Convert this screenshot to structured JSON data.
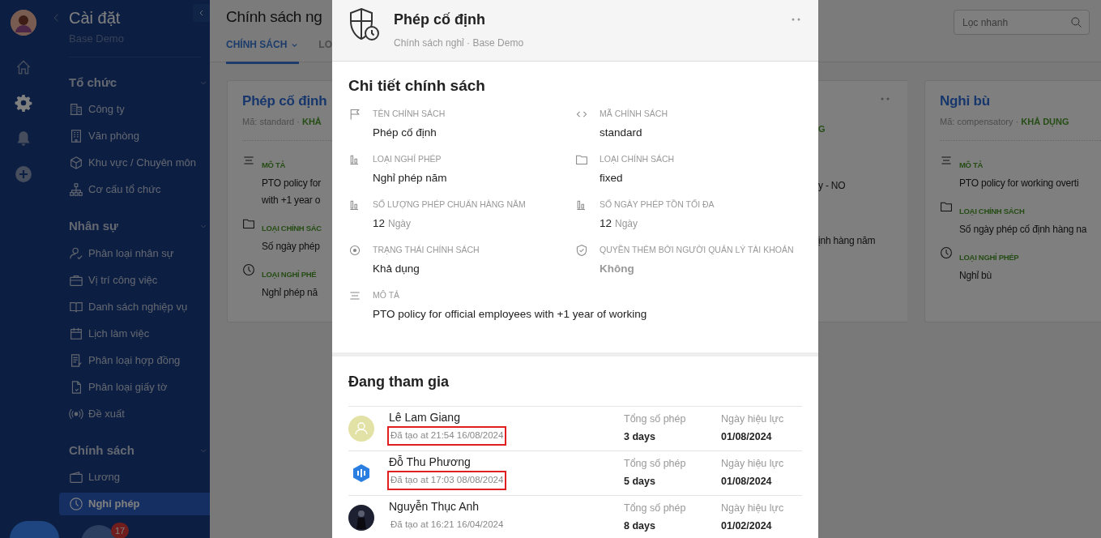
{
  "rail": {
    "items": [
      {
        "selected": false
      },
      {
        "selected": true
      },
      {
        "selected": false
      },
      {
        "selected": false
      }
    ]
  },
  "sidebar": {
    "title": "Cài đặt",
    "subtitle": "Base Demo",
    "groups": [
      {
        "title": "Tổ chức",
        "expanded": true,
        "items": [
          {
            "label": "Công ty",
            "selected": false
          },
          {
            "label": "Văn phòng",
            "selected": false
          },
          {
            "label": "Khu vực / Chuyên môn",
            "selected": false
          },
          {
            "label": "Cơ cấu tổ chức",
            "selected": false
          }
        ]
      },
      {
        "title": "Nhân sự",
        "expanded": true,
        "items": [
          {
            "label": "Phân loại nhân sự",
            "selected": false
          },
          {
            "label": "Vị trí công việc",
            "selected": false
          },
          {
            "label": "Danh sách nghiệp vụ",
            "selected": false
          },
          {
            "label": "Lịch làm việc",
            "selected": false
          },
          {
            "label": "Phân loại hợp đồng",
            "selected": false
          },
          {
            "label": "Phân loại giấy tờ",
            "selected": false
          },
          {
            "label": "Đề xuất",
            "selected": false
          }
        ]
      },
      {
        "title": "Chính sách",
        "expanded": true,
        "items": [
          {
            "label": "Lương",
            "selected": false
          },
          {
            "label": "Nghỉ phép",
            "selected": true
          }
        ]
      }
    ]
  },
  "notification_badge": "17",
  "header": {
    "title": "Chính sách ng",
    "tabs": [
      {
        "label": "CHÍNH SÁCH",
        "selected": true,
        "dropdown": true
      },
      {
        "label": "LO",
        "selected": false,
        "dropdown": false
      }
    ],
    "search": {
      "placeholder": "Lọc nhanh"
    }
  },
  "cards": [
    {
      "kind": "full",
      "menu": false,
      "title": "Phép cố định",
      "code": "Mã: standard ·",
      "status": "KHẢ",
      "fields": [
        {
          "label": "MÔ TẢ",
          "lines": [
            "PTO policy for",
            "with +1 year o"
          ]
        },
        {
          "label": "LOẠI CHÍNH SÁC",
          "lines": [
            "Số ngày phép"
          ]
        },
        {
          "label": "LOẠI NGHỈ PHÉ",
          "lines": [
            "Nghỉ phép nă"
          ]
        }
      ]
    },
    {
      "kind": "fragment",
      "menu": true,
      "status": "G",
      "lines": [
        "y - NO",
        "ịnh hàng năm"
      ]
    },
    {
      "kind": "full",
      "menu": false,
      "title": "Nghỉ bù",
      "code": "Mã: compensatory ·",
      "status": "KHẢ DỤNG",
      "fields": [
        {
          "label": "MÔ TẢ",
          "lines": [
            "PTO policy for working overti"
          ]
        },
        {
          "label": "LOẠI CHÍNH SÁCH",
          "lines": [
            "Số ngày phép cố định hàng na"
          ]
        },
        {
          "label": "LOẠI NGHỈ PHÉP",
          "lines": [
            "Nghỉ bù"
          ]
        }
      ]
    }
  ],
  "modal": {
    "title": "Phép cố định",
    "subtitle": "Chính sách nghỉ · Base Demo",
    "details_title": "Chi tiết chính sách",
    "fields": [
      {
        "label": "TÊN CHÍNH SÁCH",
        "value": "Phép cố định",
        "muted": false
      },
      {
        "label": "MÃ CHÍNH SÁCH",
        "value": "standard",
        "muted": false
      },
      {
        "label": "LOẠI NGHỈ PHÉP",
        "value": "Nghỉ phép năm",
        "muted": false
      },
      {
        "label": "LOẠI CHÍNH SÁCH",
        "value": "fixed",
        "muted": false
      },
      {
        "label": "SỐ LƯỢNG PHÉP CHUẨN HÀNG NĂM",
        "value": "12",
        "unit": "Ngày",
        "muted": false
      },
      {
        "label": "SỐ NGÀY PHÉP TỒN TỐI ĐA",
        "value": "12",
        "unit": "Ngày",
        "muted": false
      },
      {
        "label": "TRẠNG THÁI CHÍNH SÁCH",
        "value": "Khả dụng",
        "muted": false
      },
      {
        "label": "QUYỀN THÊM BỞI NGƯỜI QUẢN LÝ TÀI KHOẢN",
        "value": "Không",
        "muted": true
      },
      {
        "label": "MÔ TẢ",
        "value": "PTO policy for official employees with +1 year of working",
        "muted": false
      }
    ],
    "members_title": "Đang tham gia",
    "members": [
      {
        "kind": "placeholder",
        "name": "Lê Lam Giang",
        "created": "Đã tạo at 21:54 16/08/2024",
        "highlighted": true,
        "total_label": "Tổng số phép",
        "total": "3 days",
        "date_label": "Ngày hiệu lực",
        "date": "01/08/2024"
      },
      {
        "kind": "logo",
        "name": "Đỗ Thu Phương",
        "created": "Đã tạo at 17:03 08/08/2024",
        "highlighted": true,
        "total_label": "Tổng số phép",
        "total": "5 days",
        "date_label": "Ngày hiệu lực",
        "date": "01/08/2024"
      },
      {
        "kind": "photo",
        "name": "Nguyễn Thục Anh",
        "created": "Đã tạo at 16:21 16/04/2024",
        "highlighted": false,
        "total_label": "Tổng số phép",
        "total": "8 days",
        "date_label": "Ngày hiệu lực",
        "date": "01/02/2024"
      }
    ]
  }
}
